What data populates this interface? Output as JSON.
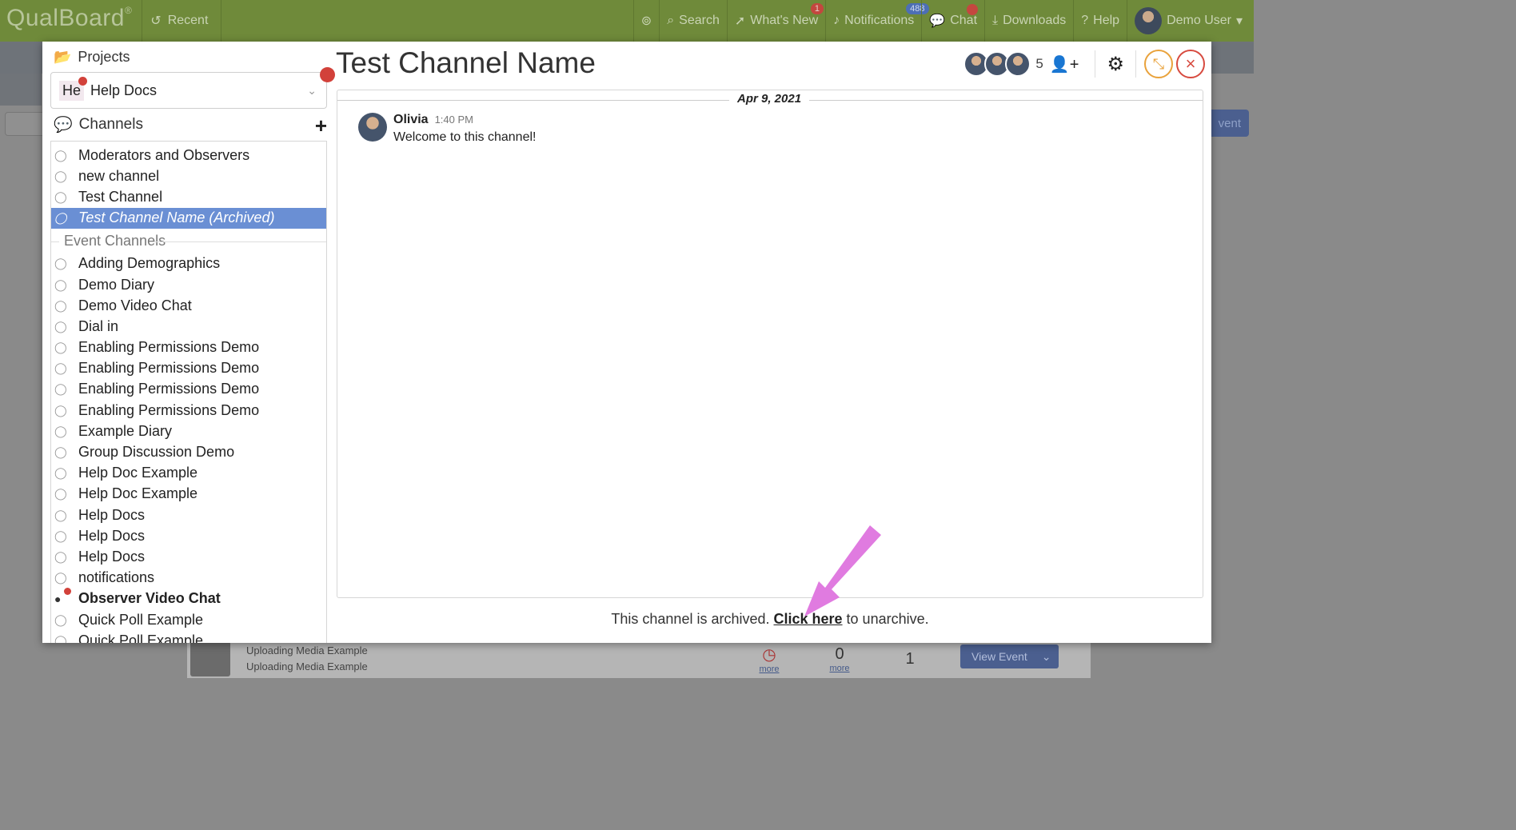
{
  "app": {
    "logo": "QualBoard",
    "logo_mark": "®",
    "recent_label": "Recent"
  },
  "nav": {
    "search": "Search",
    "whats_new": "What's New",
    "whats_new_badge": "1",
    "notifications": "Notifications",
    "notifications_badge": "488",
    "chat": "Chat",
    "downloads": "Downloads",
    "help": "Help",
    "user": "Demo User"
  },
  "background": {
    "view_button": "vent",
    "card_title": "Uploading Media Example",
    "card_subtitle": "Uploading Media Example",
    "stat_a": "0",
    "stat_b": "1",
    "more_a": "more",
    "more_b": "more",
    "view_event": "View Event"
  },
  "sidebar": {
    "projects_label": "Projects",
    "project_chip": "He",
    "project_name": "Help Docs",
    "channels_label": "Channels",
    "channels": [
      "Moderators and Observers",
      "new channel",
      "Test Channel",
      "Test Channel Name (Archived)"
    ],
    "event_channels_label": "Event Channels",
    "event_channels": [
      "Adding Demographics",
      "Demo Diary",
      "Demo Video Chat",
      "Dial in",
      "Enabling Permissions Demo",
      "Enabling Permissions Demo",
      "Enabling Permissions Demo",
      "Enabling Permissions Demo",
      "Example Diary",
      "Group Discussion Demo",
      "Help Doc Example",
      "Help Doc Example",
      "Help Docs",
      "Help Docs",
      "Help Docs",
      "notifications",
      "Observer Video Chat",
      "Quick Poll Example",
      "Quick Poll Example"
    ]
  },
  "channel": {
    "title": "Test Channel Name",
    "member_count": "5",
    "date": "Apr 9, 2021",
    "message": {
      "author": "Olivia",
      "time": "1:40 PM",
      "text": "Welcome to this channel!"
    },
    "archived_text_before": "This channel is archived. ",
    "archived_link": "Click here",
    "archived_text_after": " to unarchive."
  },
  "colors": {
    "topbar": "#6f8a3a",
    "selected": "#6a8fd4",
    "annotation_arrow": "#e07be0",
    "close": "#d74a3f",
    "minimize": "#e9a23b"
  }
}
